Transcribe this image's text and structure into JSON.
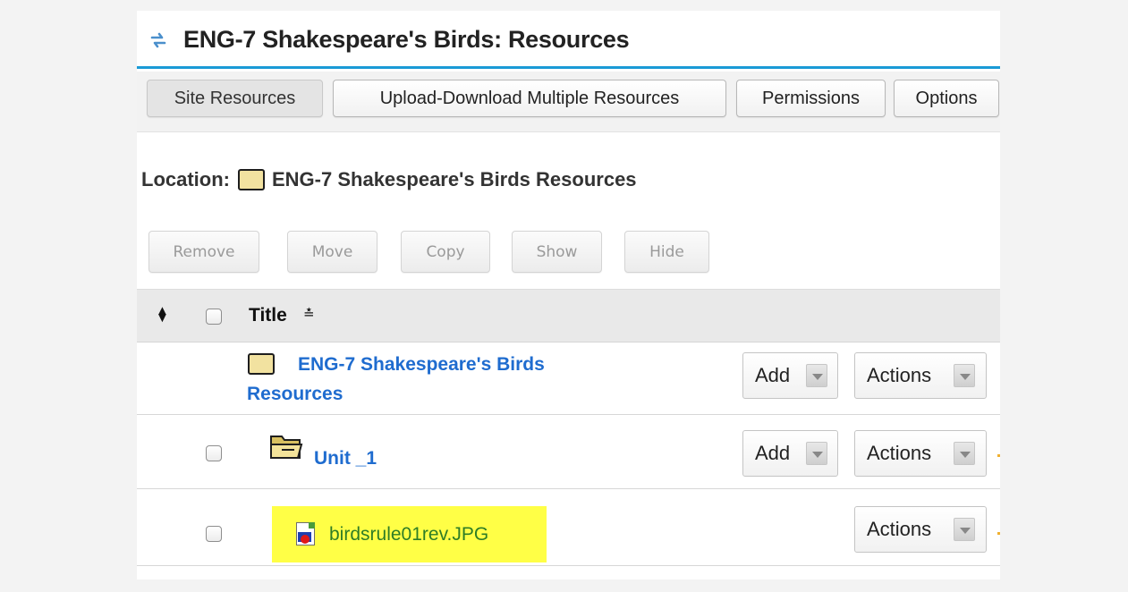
{
  "header": {
    "title": "ENG-7 Shakespeare's Birds: Resources",
    "refresh_icon": "refresh-arrows-icon",
    "accent_color": "#1a9ad6"
  },
  "tabs": [
    {
      "label": "Site Resources",
      "active": true
    },
    {
      "label": "Upload-Download Multiple Resources",
      "active": false
    },
    {
      "label": "Permissions",
      "active": false
    },
    {
      "label": "Options",
      "active": false
    }
  ],
  "location": {
    "label": "Location:",
    "folder_icon": "folder-icon",
    "path": "ENG-7 Shakespeare's Birds Resources"
  },
  "actions": {
    "remove": "Remove",
    "move": "Move",
    "copy": "Copy",
    "show": "Show",
    "hide": "Hide"
  },
  "table": {
    "header": {
      "title": "Title",
      "sort_icon": "sort-updown-icon",
      "title_sort_icon": "sort-ascending-icon"
    },
    "rows": [
      {
        "name_line1": "ENG-7 Shakespeare's Birds",
        "name_line2": "Resources",
        "type": "folder",
        "add_label": "Add",
        "actions_label": "Actions"
      },
      {
        "name": "Unit _1",
        "type": "folder-open",
        "add_label": "Add",
        "actions_label": "Actions"
      },
      {
        "name": "birdsrule01rev.JPG",
        "type": "image-file",
        "actions_label": "Actions",
        "highlighted": true,
        "highlight_color": "#ffff46"
      }
    ]
  },
  "colors": {
    "link": "#1f6ccf",
    "file_link": "#2e7d26"
  }
}
